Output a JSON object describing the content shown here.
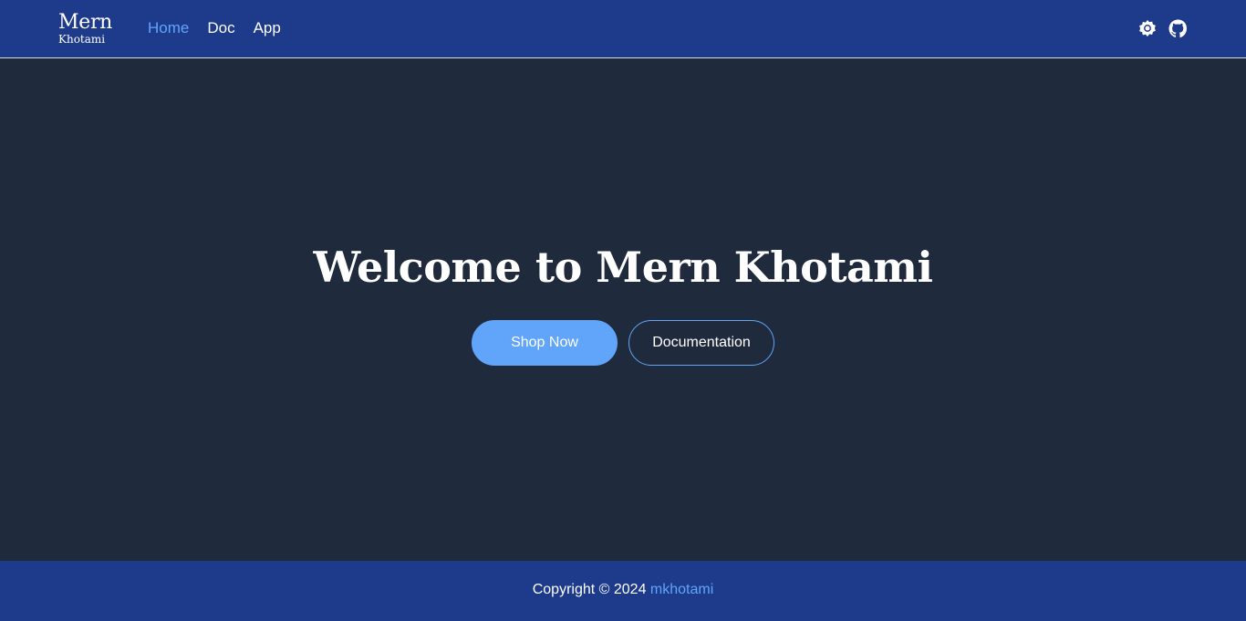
{
  "colors": {
    "header_bg": "#1e3a8a",
    "hero_bg": "#1f2a3c",
    "accent": "#60a5fa",
    "text": "#ffffff"
  },
  "header": {
    "logo_main": "Mern",
    "logo_sub": "Khotami",
    "nav": [
      {
        "label": "Home",
        "active": true
      },
      {
        "label": "Doc",
        "active": false
      },
      {
        "label": "App",
        "active": false
      }
    ],
    "icons": [
      {
        "name": "theme-toggle-icon",
        "glyph": "sun"
      },
      {
        "name": "github-icon",
        "glyph": "github"
      }
    ]
  },
  "hero": {
    "title": "Welcome to Mern Khotami",
    "primary_button": "Shop Now",
    "secondary_button": "Documentation"
  },
  "footer": {
    "prefix": "Copyright © 2024 ",
    "link_text": "mkhotami"
  }
}
